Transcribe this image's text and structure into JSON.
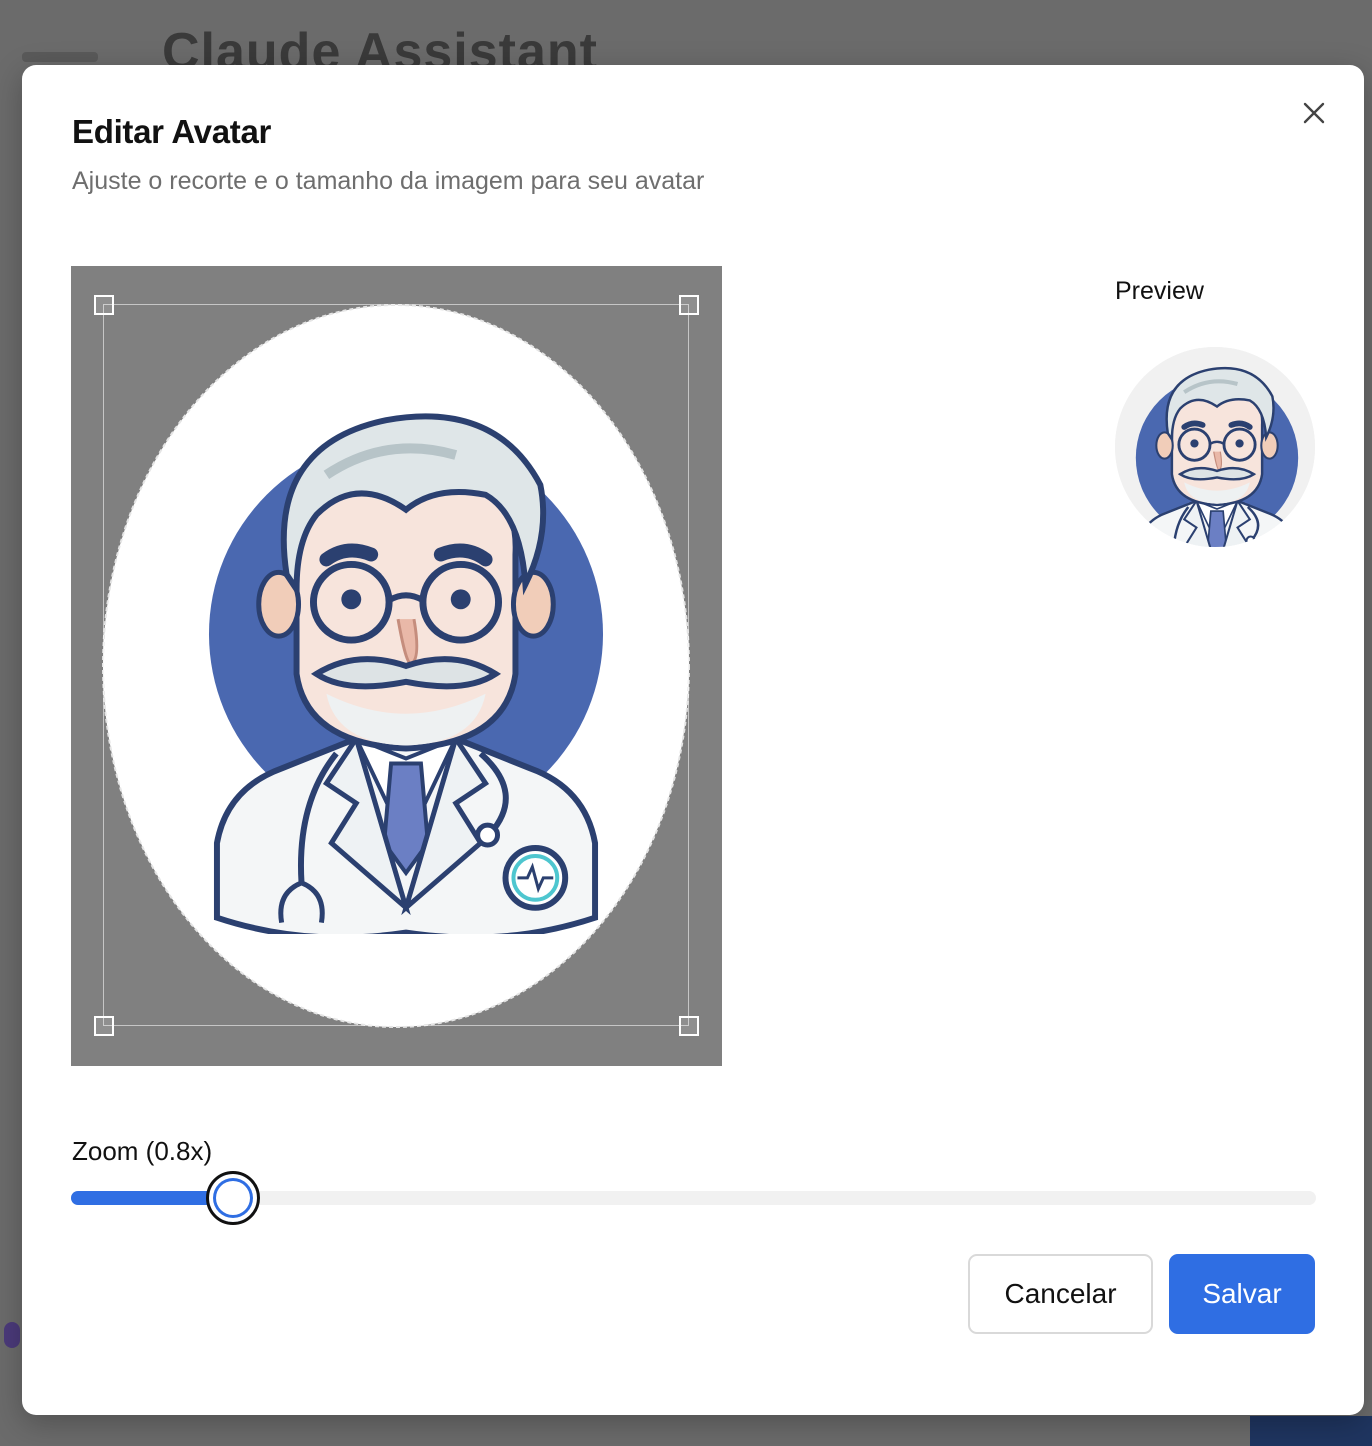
{
  "background": {
    "title": "Claude Assistant"
  },
  "dialog": {
    "title": "Editar Avatar",
    "subtitle": "Ajuste o recorte e o tamanho da imagem para seu avatar",
    "close_icon": "close-icon",
    "preview_label": "Preview",
    "zoom": {
      "label": "Zoom (0.8x)",
      "value": 0.8,
      "fill_fraction": 0.13
    },
    "buttons": {
      "cancel": "Cancelar",
      "save": "Salvar"
    },
    "image": {
      "subject": "doctor-avatar-illustration"
    }
  },
  "colors": {
    "accent": "#2f6ee3",
    "overlay": "#6b6b6b",
    "crop_background": "#808080",
    "illustration_blue": "#4a68b0",
    "outline_navy": "#2b4070"
  }
}
